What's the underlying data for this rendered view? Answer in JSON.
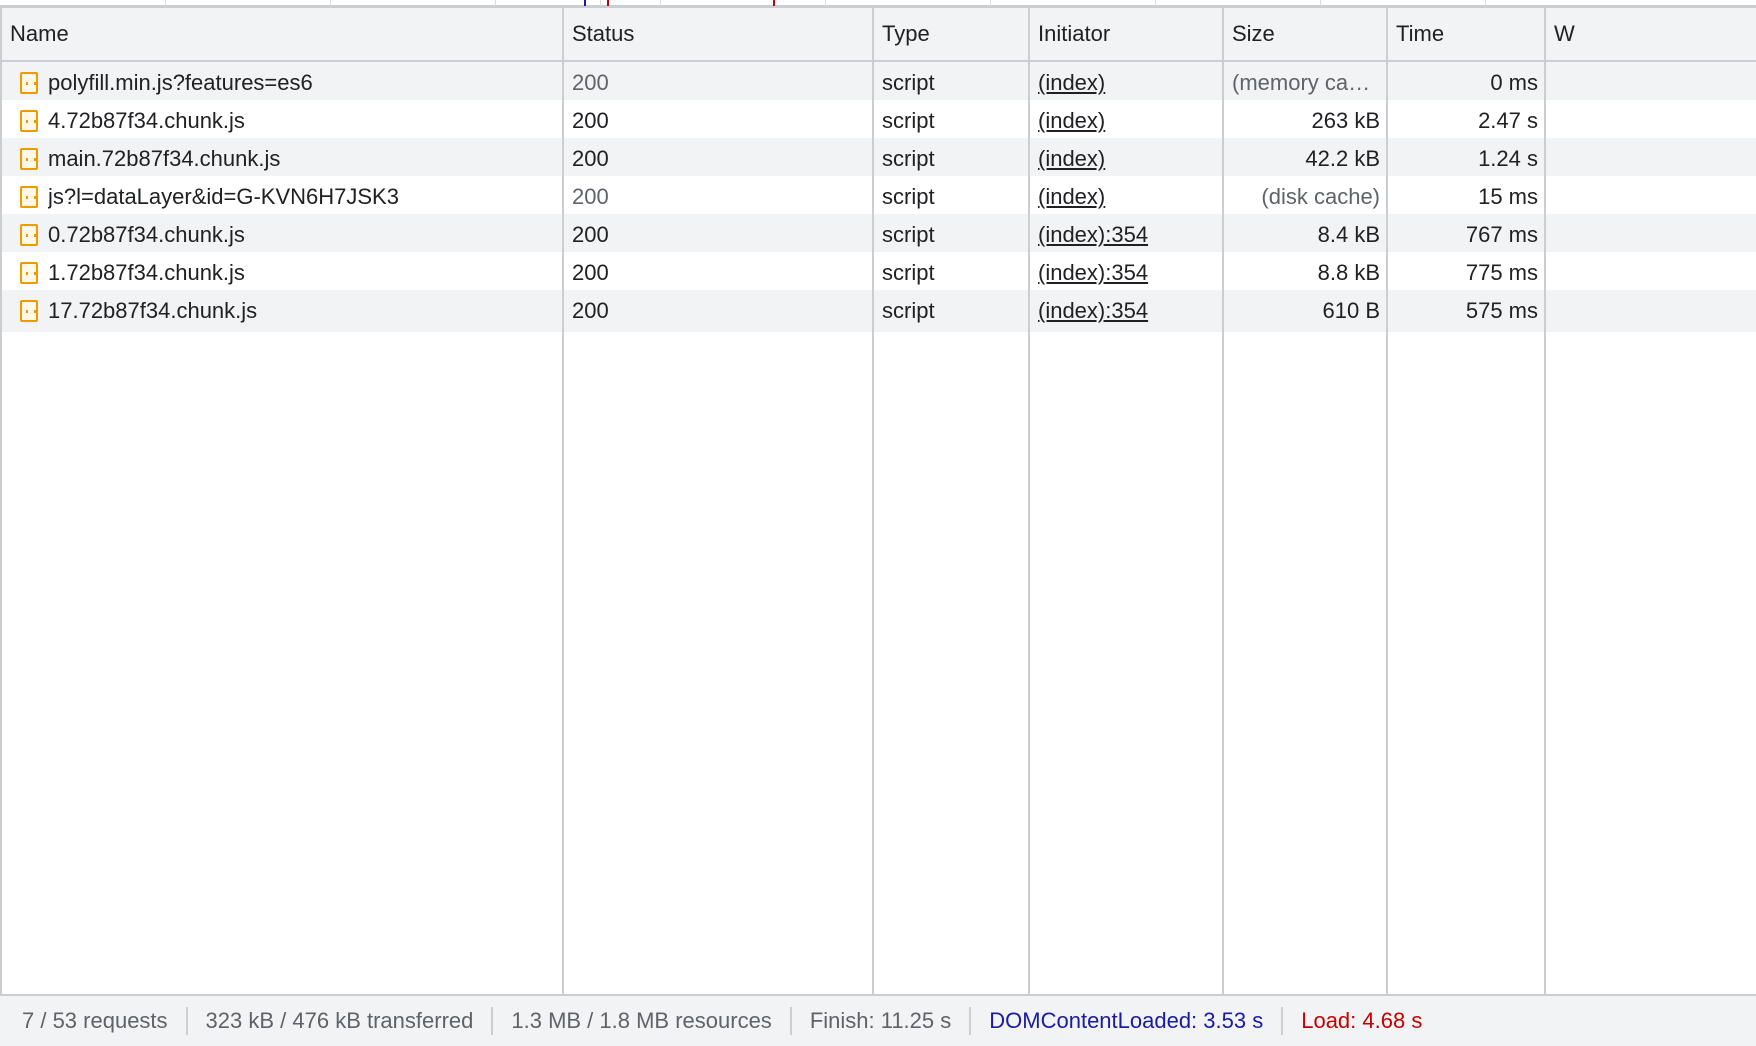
{
  "columns": {
    "name": "Name",
    "status": "Status",
    "type": "Type",
    "initiator": "Initiator",
    "size": "Size",
    "time": "Time",
    "waterfall": "W"
  },
  "requests": [
    {
      "name": "polyfill.min.js?features=es6",
      "status": "200",
      "type": "script",
      "initiator": "(index)",
      "size": "(memory cac…",
      "time": "0 ms"
    },
    {
      "name": "4.72b87f34.chunk.js",
      "status": "200",
      "type": "script",
      "initiator": "(index)",
      "size": "263 kB",
      "time": "2.47 s"
    },
    {
      "name": "main.72b87f34.chunk.js",
      "status": "200",
      "type": "script",
      "initiator": "(index)",
      "size": "42.2 kB",
      "time": "1.24 s"
    },
    {
      "name": "js?l=dataLayer&id=G-KVN6H7JSK3",
      "status": "200",
      "type": "script",
      "initiator": "(index)",
      "size": "(disk cache)",
      "time": "15 ms"
    },
    {
      "name": "0.72b87f34.chunk.js",
      "status": "200",
      "type": "script",
      "initiator": "(index):354",
      "size": "8.4 kB",
      "time": "767 ms"
    },
    {
      "name": "1.72b87f34.chunk.js",
      "status": "200",
      "type": "script",
      "initiator": "(index):354",
      "size": "8.8 kB",
      "time": "775 ms"
    },
    {
      "name": "17.72b87f34.chunk.js",
      "status": "200",
      "type": "script",
      "initiator": "(index):354",
      "size": "610 B",
      "time": "575 ms"
    }
  ],
  "statusbar": {
    "requests": "7 / 53 requests",
    "transferred": "323 kB / 476 kB transferred",
    "resources": "1.3 MB / 1.8 MB resources",
    "finish": "Finish: 11.25 s",
    "dom_content_loaded": "DOMContentLoaded: 3.53 s",
    "load": "Load: 4.68 s"
  },
  "colors": {
    "dom_content_loaded": "#1a1aa6",
    "load": "#c80000",
    "script_icon": "#f29900"
  },
  "icons": {
    "request_type": "script-file-icon"
  }
}
